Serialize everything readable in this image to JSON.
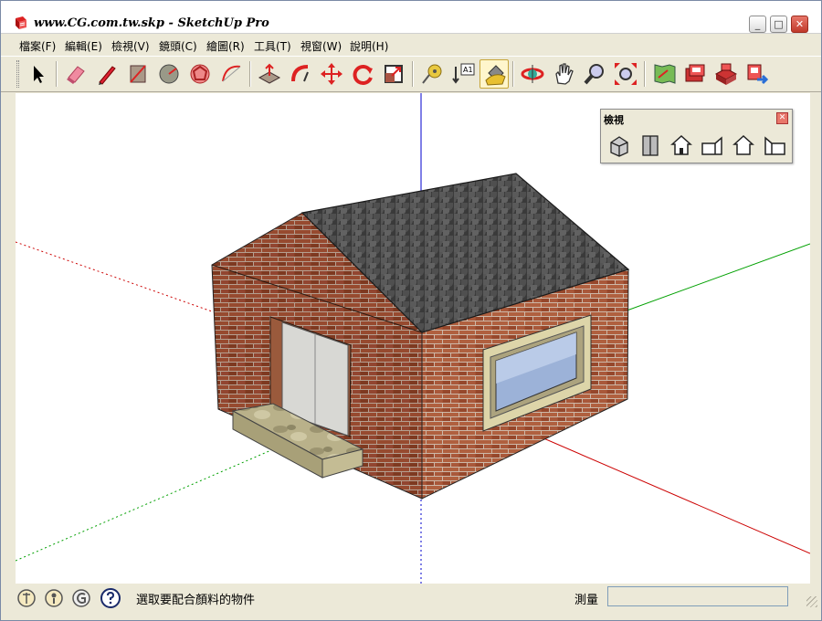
{
  "window": {
    "title": "www.CG.com.tw.skp - SketchUp Pro",
    "minimize_label": "_",
    "maximize_label": "□",
    "close_label": "✕"
  },
  "menu": {
    "items": [
      {
        "label": "檔案(F)"
      },
      {
        "label": "編輯(E)"
      },
      {
        "label": "檢視(V)"
      },
      {
        "label": "鏡頭(C)"
      },
      {
        "label": "繪圖(R)"
      },
      {
        "label": "工具(T)"
      },
      {
        "label": "視窗(W)"
      },
      {
        "label": "說明(H)"
      }
    ]
  },
  "toolbar": {
    "tools": [
      {
        "icon": "select-arrow-icon"
      },
      {
        "icon": "eraser-icon"
      },
      {
        "icon": "pencil-line-icon"
      },
      {
        "icon": "rectangle-icon"
      },
      {
        "icon": "circle-icon"
      },
      {
        "icon": "polygon-icon"
      },
      {
        "icon": "arc-icon"
      },
      {
        "icon": "push-pull-icon"
      },
      {
        "icon": "follow-me-icon"
      },
      {
        "icon": "move-icon"
      },
      {
        "icon": "rotate-icon"
      },
      {
        "icon": "scale-icon"
      },
      {
        "icon": "tape-measure-icon"
      },
      {
        "icon": "text-label-icon"
      },
      {
        "icon": "paint-bucket-icon"
      },
      {
        "icon": "orbit-icon"
      },
      {
        "icon": "pan-icon"
      },
      {
        "icon": "zoom-icon"
      },
      {
        "icon": "zoom-extents-icon"
      },
      {
        "icon": "get-models-icon"
      },
      {
        "icon": "share-model-icon"
      },
      {
        "icon": "components-icon"
      },
      {
        "icon": "export-icon"
      }
    ],
    "text_tool_glyph": "A1",
    "active_tool": "paint-bucket-icon"
  },
  "views_panel": {
    "title": "檢視",
    "close_label": "✕",
    "buttons": [
      {
        "icon": "iso-view-icon"
      },
      {
        "icon": "top-view-icon"
      },
      {
        "icon": "front-view-icon"
      },
      {
        "icon": "right-view-icon"
      },
      {
        "icon": "back-view-icon"
      },
      {
        "icon": "left-view-icon"
      }
    ]
  },
  "statusbar": {
    "message": "選取要配合顏料的物件",
    "measurement_label": "測量",
    "measurement_value": ""
  },
  "colors": {
    "axis_red": "#cc0000",
    "axis_green": "#00a000",
    "axis_blue": "#0000cc",
    "brick": "#9a4a2e",
    "roof": "#4e4e4e",
    "active_tool_bg": "#fff6cc"
  }
}
